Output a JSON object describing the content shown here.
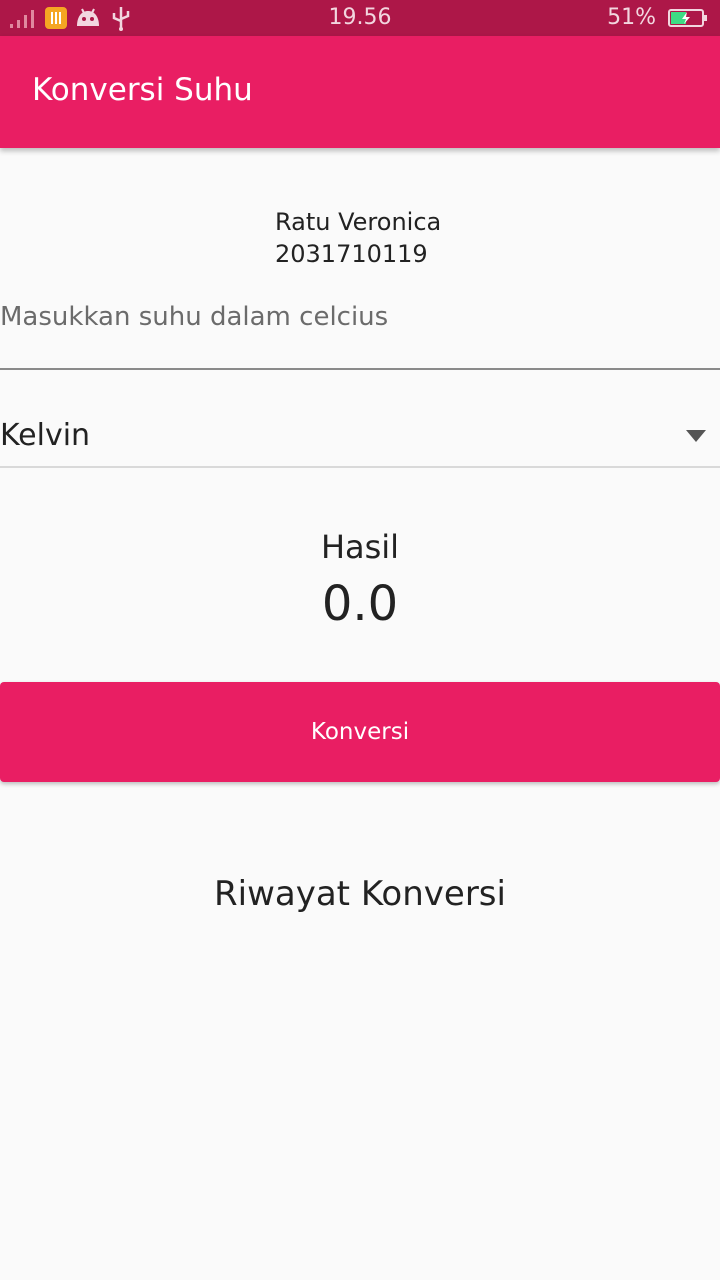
{
  "status_bar": {
    "time": "19.56",
    "battery_percent": "51%",
    "icons": [
      "signal-icon",
      "tool-icon",
      "android-icon",
      "usb-icon",
      "battery-charging-icon"
    ],
    "battery_level": 0.51,
    "color": "#ad1748"
  },
  "app_bar": {
    "title": "Konversi Suhu",
    "color": "#e91e63"
  },
  "student": {
    "name": "Ratu Veronica",
    "nim": "2031710119"
  },
  "input": {
    "value": "",
    "placeholder": "Masukkan suhu dalam celcius"
  },
  "spinner": {
    "selected": "Kelvin"
  },
  "result": {
    "label": "Hasil",
    "value": "0.0"
  },
  "button": {
    "label": "Konversi",
    "color": "#e91e63"
  },
  "history": {
    "title": "Riwayat Konversi"
  }
}
